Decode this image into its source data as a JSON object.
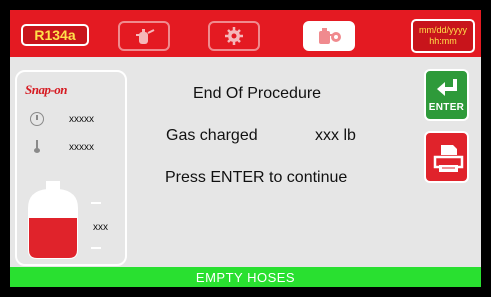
{
  "header": {
    "gas_type": "R134a",
    "datetime_date": "mm/dd/yyyy",
    "datetime_time": "hh:mm",
    "tabs": [
      {
        "icon": "tank-wrench-icon",
        "active": false
      },
      {
        "icon": "gear-icon",
        "active": false
      },
      {
        "icon": "oil-can-icon",
        "active": true
      }
    ]
  },
  "left_panel": {
    "brand": "Snap-on",
    "pressure_value": "xxxxx",
    "temperature_value": "xxxxx",
    "tank_value": "xxx",
    "tank_color": "#e0232b"
  },
  "main": {
    "title": "End Of Procedure",
    "gas_charged_label": "Gas charged",
    "gas_charged_value": "xxx lb",
    "prompt": "Press ENTER to continue"
  },
  "side_buttons": {
    "enter_label": "ENTER",
    "enter_icon": "return-arrow-icon",
    "print_icon": "printer-icon"
  },
  "status": {
    "text": "EMPTY HOSES",
    "color": "#29e030"
  }
}
